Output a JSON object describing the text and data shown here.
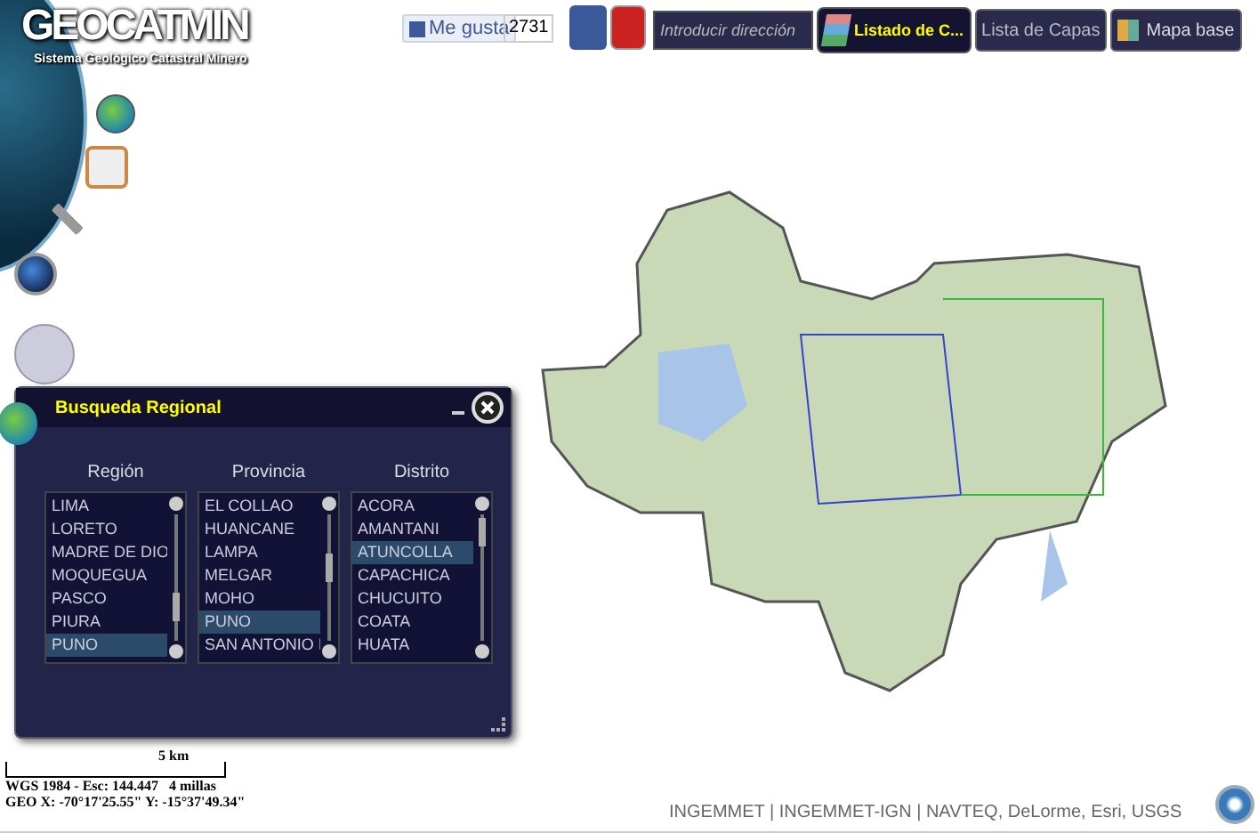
{
  "header": {
    "logo": "GEOCATMIN",
    "subtitle": "Sistema Geológico Catastral Minero",
    "like_button": "Me gusta",
    "like_count": "2731",
    "search": {
      "placeholder": "Introducir dirección"
    },
    "layers_popup": "Listado de C...",
    "buttons": [
      "Lista de Capas",
      "Mapa base"
    ]
  },
  "panel": {
    "title": "Busqueda Regional",
    "columns": [
      {
        "heading": "Región",
        "items": [
          {
            "label": "LIMA",
            "selected": false
          },
          {
            "label": "LORETO",
            "selected": false
          },
          {
            "label": "MADRE DE DIO",
            "selected": false
          },
          {
            "label": "MOQUEGUA",
            "selected": false
          },
          {
            "label": "PASCO",
            "selected": false
          },
          {
            "label": "PIURA",
            "selected": false
          },
          {
            "label": "PUNO",
            "selected": true
          }
        ]
      },
      {
        "heading": "Provincia",
        "items": [
          {
            "label": "EL COLLAO",
            "selected": false
          },
          {
            "label": "HUANCANE",
            "selected": false
          },
          {
            "label": "LAMPA",
            "selected": false
          },
          {
            "label": "MELGAR",
            "selected": false
          },
          {
            "label": "MOHO",
            "selected": false
          },
          {
            "label": "PUNO",
            "selected": true
          },
          {
            "label": "SAN ANTONIO I",
            "selected": false
          }
        ]
      },
      {
        "heading": "Distrito",
        "items": [
          {
            "label": "ACORA",
            "selected": false
          },
          {
            "label": "AMANTANI",
            "selected": false
          },
          {
            "label": "ATUNCOLLA",
            "selected": true
          },
          {
            "label": "CAPACHICA",
            "selected": false
          },
          {
            "label": "CHUCUITO",
            "selected": false
          },
          {
            "label": "COATA",
            "selected": false
          },
          {
            "label": "HUATA",
            "selected": false
          }
        ]
      }
    ]
  },
  "scale": {
    "km": "5 km",
    "miles": "4 millas",
    "projection": "WGS 1984 - Esc: 144.447",
    "coords": "GEO X: -70°17'25.55\" Y: -15°37'49.34\""
  },
  "attribution": "INGEMMET | INGEMMET-IGN | NAVTEQ, DeLorme, Esri, USGS"
}
